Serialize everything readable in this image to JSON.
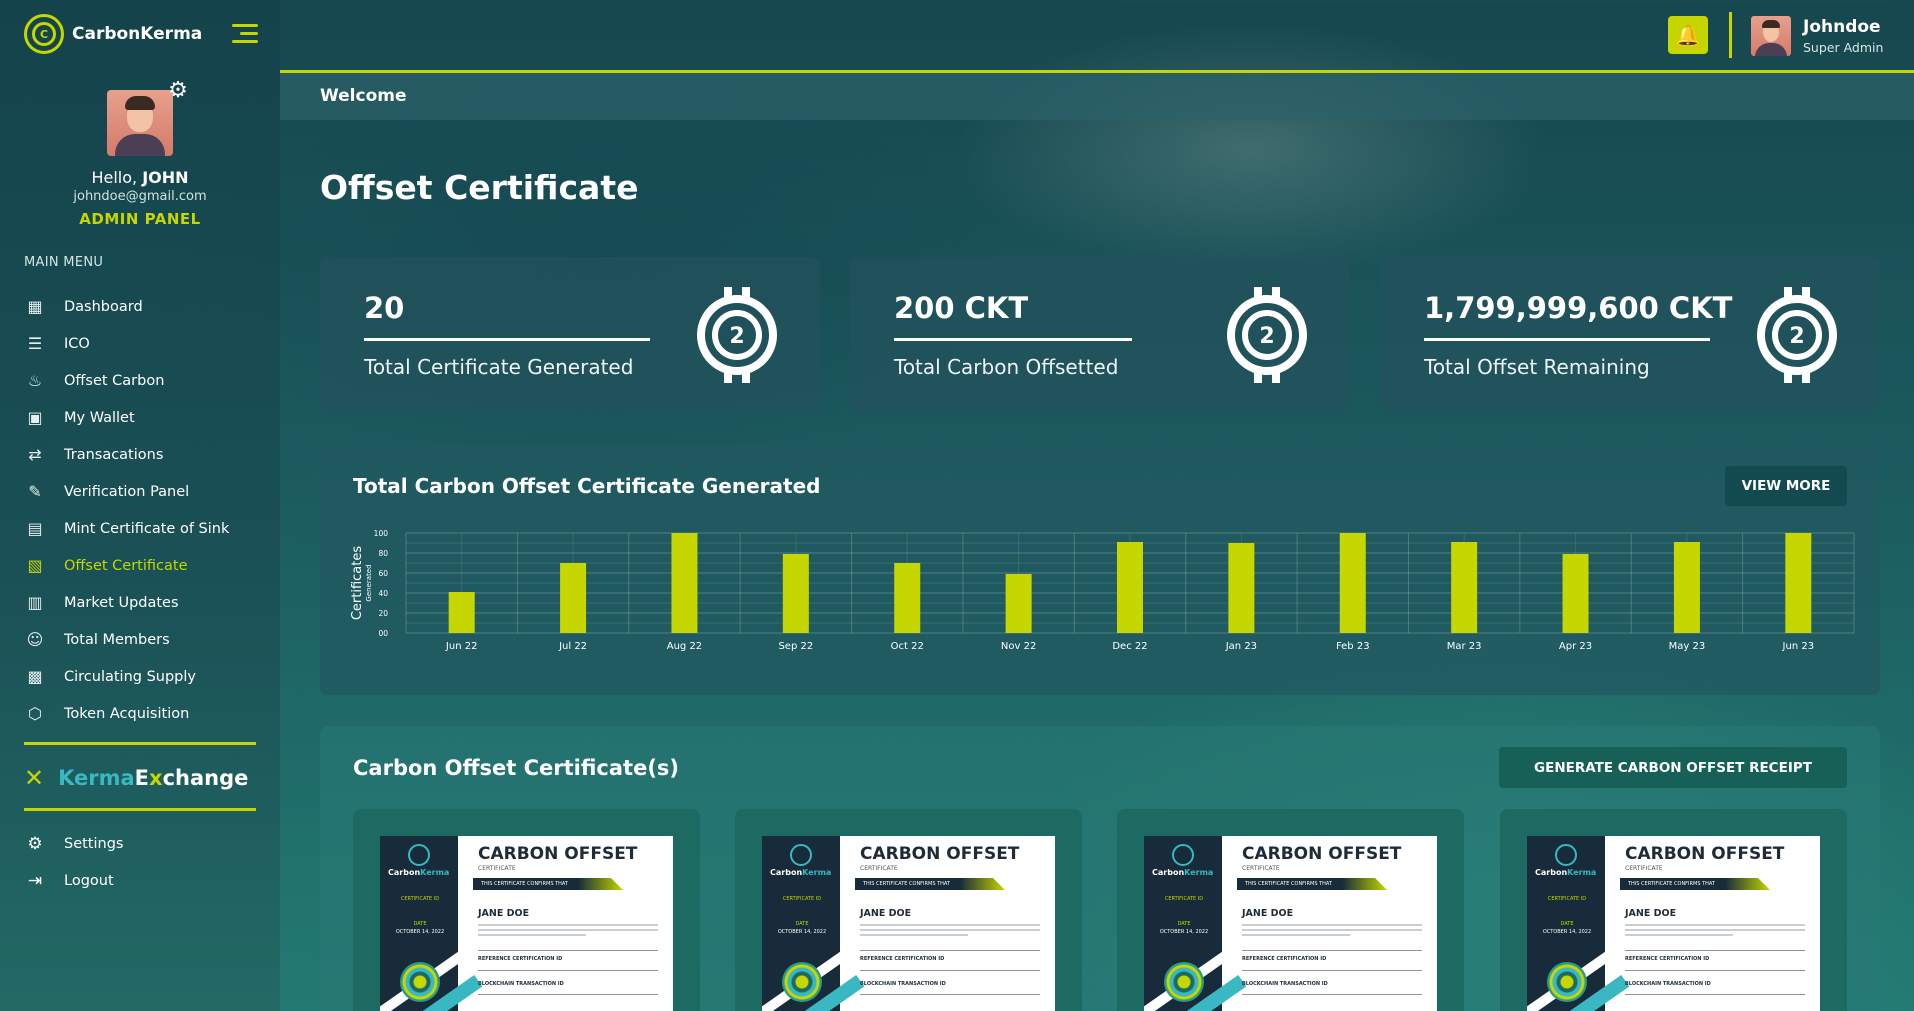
{
  "brand": {
    "name": "CarbonKerma"
  },
  "profile": {
    "greeting": "Hello,",
    "name": "JOHN",
    "email": "johndoe@gmail.com",
    "panel": "ADMIN PANEL"
  },
  "menu": {
    "title": "MAIN MENU",
    "items": [
      {
        "label": "Dashboard",
        "icon": "dashboard-icon"
      },
      {
        "label": "ICO",
        "icon": "ico-icon"
      },
      {
        "label": "Offset Carbon",
        "icon": "flame-icon"
      },
      {
        "label": "My Wallet",
        "icon": "wallet-icon"
      },
      {
        "label": "Transacations",
        "icon": "transactions-icon"
      },
      {
        "label": "Verification Panel",
        "icon": "verification-icon"
      },
      {
        "label": "Mint Certificate of Sink",
        "icon": "mint-icon"
      },
      {
        "label": "Offset Certificate",
        "icon": "certificate-icon",
        "active": true
      },
      {
        "label": "Market Updates",
        "icon": "chart-icon"
      },
      {
        "label": "Total Members",
        "icon": "members-icon"
      },
      {
        "label": "Circulating Supply",
        "icon": "supply-icon"
      },
      {
        "label": "Token Acquisition",
        "icon": "token-icon"
      }
    ]
  },
  "exchange": {
    "part1": "Kerma",
    "part2": "E",
    "part3": "x",
    "part4": "change"
  },
  "bottom_menu": {
    "settings": "Settings",
    "logout": "Logout"
  },
  "topbar": {
    "user_name": "Johndoe",
    "user_role": "Super Admin"
  },
  "welcome": "Welcome",
  "page_title": "Offset Certificate",
  "stats": [
    {
      "value": "20",
      "label": "Total Certificate Generated"
    },
    {
      "value": "200 CKT",
      "label": "Total Carbon Offsetted"
    },
    {
      "value": "1,799,999,600 CKT",
      "label": "Total Offset Remaining"
    }
  ],
  "stat_icon_text": "2",
  "chart_panel": {
    "title": "Total Carbon Offset Certificate Generated",
    "view_more": "VIEW MORE"
  },
  "chart_data": {
    "type": "bar",
    "categories": [
      "Jun 22",
      "Jul 22",
      "Aug 22",
      "Sep 22",
      "Oct 22",
      "Nov 22",
      "Dec 22",
      "Jan 23",
      "Feb 23",
      "Mar 23",
      "Apr 23",
      "May 23",
      "Jun 23"
    ],
    "values": [
      41,
      70,
      100,
      79,
      70,
      59,
      91,
      90,
      100,
      91,
      79,
      91,
      100
    ],
    "ylabel": "Certificates",
    "ylabel_sub": "Generated",
    "ylim": [
      0,
      100
    ],
    "yticks": [
      "00",
      "20",
      "40",
      "60",
      "80",
      "100"
    ],
    "grid": true,
    "bar_color": "#c5d600"
  },
  "cert_panel": {
    "title": "Carbon Offset Certificate(s)",
    "generate_button": "GENERATE CARBON OFFSET RECEIPT"
  },
  "certificate": {
    "heading": "CARBON OFFSET",
    "sub": "CERTIFICATE",
    "confirm": "THIS CERTIFICATE CONFIRMS THAT",
    "person": "JANE DOE",
    "left_brand_a": "Carbon",
    "left_brand_b": "Kerma",
    "cert_id_label": "CERTIFICATE ID",
    "date_label": "DATE",
    "date": "OCTOBER 14, 2022",
    "ref_label": "REFERENCE CERTIFICATION ID",
    "chain_label": "BLOCKCHAIN TRANSACTION ID"
  },
  "colors": {
    "accent": "#c5d600",
    "teal": "#39b7c2",
    "panel": "#22525c"
  }
}
